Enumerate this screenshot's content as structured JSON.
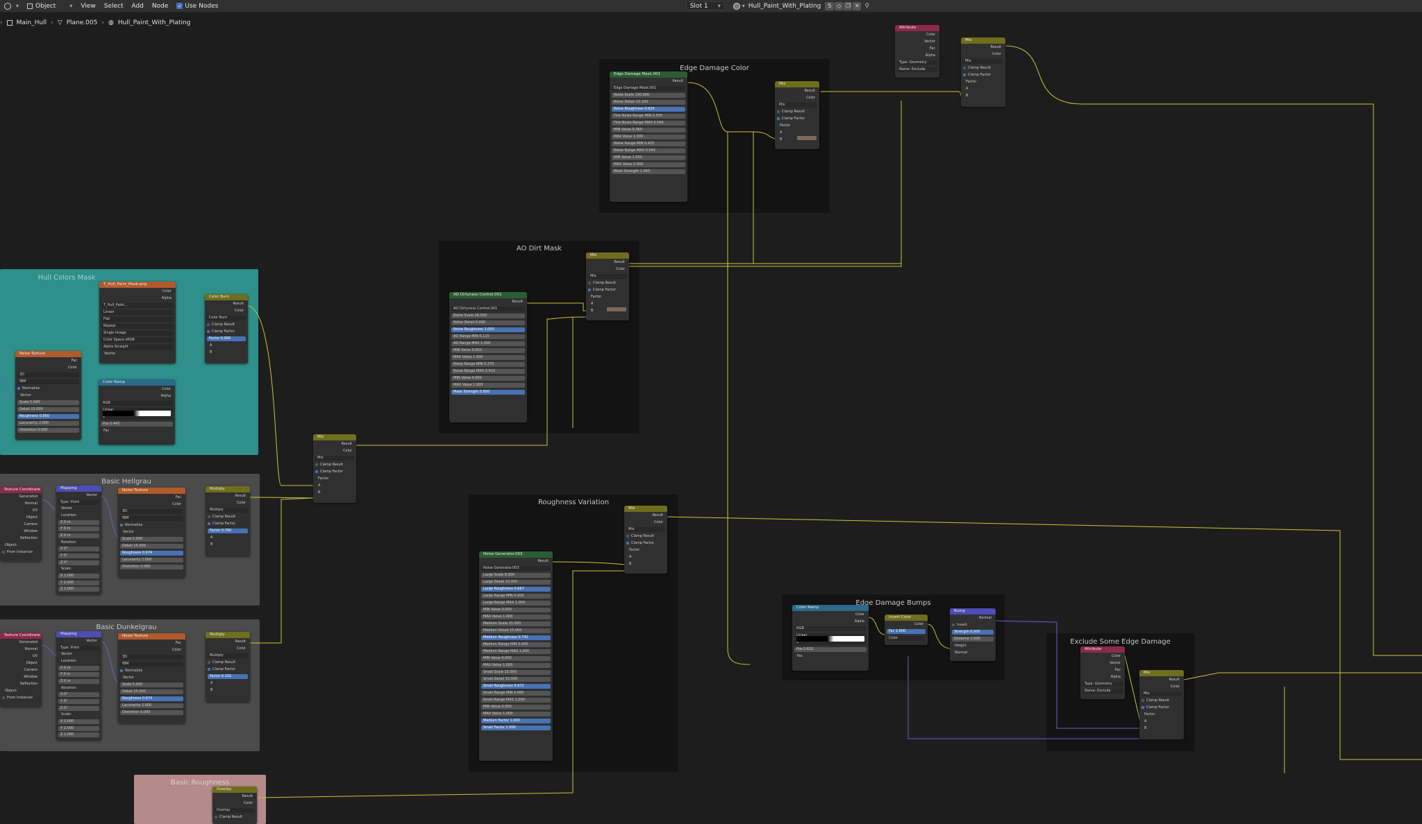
{
  "header": {
    "mode": "Object",
    "menus": [
      "View",
      "Select",
      "Add",
      "Node"
    ],
    "use_nodes": "Use Nodes",
    "slot": "Slot 1",
    "material": "Hull_Paint_With_Plating",
    "user_count": "5"
  },
  "breadcrumb": [
    "Main_Hull",
    "Plane.005",
    "Hull_Paint_With_Plating"
  ],
  "frames": {
    "edge_damage_color": "Edge Damage Color",
    "ao_dirt_mask": "AO Dirt Mask",
    "hull_colors_mask": "Hull Colors Mask",
    "basic_hellgrau": "Basic Hellgrau",
    "roughness_variation": "Roughness Variation",
    "basic_dunkelgrau": "Basic Dunkelgrau",
    "basic_roughness": "Basic Roughness",
    "edge_damage_bumps": "Edge Damage Bumps",
    "exclude_edge_damage": "Exclude Some Edge Damage"
  },
  "nodes": {
    "edge_mask": {
      "title": "Edge Damage Mask.001",
      "rows": [
        "Result",
        "Edge Damage Mask.001",
        "Noise Scale 100.000",
        "Noise Detail 15.100",
        "Noise Roughness 0.620",
        "Fine Noise Range MIN 0.550",
        "Fine Noise Range MAX 0.560",
        "MIN Value 0.360",
        "MAX Value 1.000",
        "Noise Range MIN 0.425",
        "Noise Range MAX 0.545",
        "MIN Value 1.000",
        "MAX Value 0.000",
        "Mask Strength 1.000"
      ]
    },
    "mix_edge": {
      "title": "Mix",
      "rows": [
        "Result",
        "Color",
        "Mix",
        "Clamp Result",
        "Clamp Factor",
        "Factor",
        "A",
        "B"
      ]
    },
    "attribute_top": {
      "title": "Attribute",
      "rows": [
        "Color",
        "Vector",
        "Fac",
        "Alpha",
        "Type: Geometry",
        "Name: Exclude"
      ]
    },
    "mix_top": {
      "title": "Mix",
      "rows": [
        "Result",
        "Color",
        "Mix",
        "Clamp Result",
        "Clamp Factor",
        "Factor",
        "A",
        "B"
      ]
    },
    "mix_ao": {
      "title": "Mix",
      "rows": [
        "Result",
        "Color",
        "Mix",
        "Clamp Result",
        "Clamp Factor",
        "Factor",
        "A",
        "B"
      ]
    },
    "ao_control": {
      "title": "AO Dirtyness Control.001",
      "rows": [
        "Result",
        "AO Dirtyness Control.001",
        "Noise Scale 26.000",
        "Noise Detail 6.000",
        "Noise Roughness 1.000",
        "AO Range MIN 0.115",
        "AO Range MAX 1.000",
        "MIN Value 0.000",
        "MAX Value 1.000",
        "Noise Range MIN 0.370",
        "Noise Range MAX 0.410",
        "MIN Value 0.000",
        "MAX Value 1.000",
        "Mask Strength 0.650"
      ]
    },
    "image_texture": {
      "title": "T_Hull_Paint_Mask.png",
      "rows": [
        "Color",
        "Alpha",
        "T_Hull_Paint...",
        "Linear",
        "Flat",
        "Repeat",
        "Single Image",
        "Color Space sRGB",
        "Alpha Straight",
        "Vector"
      ]
    },
    "color_burn": {
      "title": "Color Burn",
      "rows": [
        "Result",
        "Color",
        "Color Burn",
        "Clamp Result",
        "Clamp Factor",
        "Factor 0.900",
        "A",
        "B"
      ]
    },
    "noise_hull": {
      "title": "Noise Texture",
      "rows": [
        "Fac",
        "Color",
        "3D",
        "fBM",
        "Normalize",
        "Vector",
        "Scale 5.000",
        "Detail 15.000",
        "Roughness 0.850",
        "Lacunarity 2.000",
        "Distortion 0.000"
      ]
    },
    "color_ramp": {
      "title": "Color Ramp",
      "rows": [
        "Color",
        "Alpha",
        "RGB",
        "Linear",
        "1",
        "Pos 0.445",
        "Fac"
      ]
    },
    "mix_center": {
      "title": "Mix",
      "rows": [
        "Result",
        "Color",
        "Mix",
        "Clamp Result",
        "Clamp Factor",
        "Factor",
        "A",
        "B"
      ]
    },
    "texcoord_1": {
      "title": "Texture Coordinate",
      "rows": [
        "Generated",
        "Normal",
        "UV",
        "Object",
        "Camera",
        "Window",
        "Reflection",
        "Object:",
        "From Instancer"
      ]
    },
    "mapping_1": {
      "title": "Mapping",
      "rows": [
        "Vector",
        "Type: Point",
        "Vector",
        "Location:",
        "X 0 m",
        "Y 0 m",
        "Z 0 m",
        "Rotation:",
        "X 0°",
        "Y 0°",
        "Z 0°",
        "Scale:",
        "X 2.000",
        "Y 2.000",
        "Z 2.000"
      ]
    },
    "noise_hell": {
      "title": "Noise Texture",
      "rows": [
        "Fac",
        "Color",
        "3D",
        "fBM",
        "Normalize",
        "Vector",
        "Scale 5.000",
        "Detail 15.000",
        "Roughness 0.674",
        "Lacunarity 2.000",
        "Distortion 0.000"
      ]
    },
    "multiply_hell": {
      "title": "Multiply",
      "rows": [
        "Result",
        "Color",
        "Multiply",
        "Clamp Result",
        "Clamp Factor",
        "Factor 0.700",
        "A",
        "B"
      ]
    },
    "noise_gen": {
      "title": "Noise Generator.003",
      "rows": [
        "Result",
        "Noise Generator.003",
        "Large Scale 8.000",
        "Large Detail 15.000",
        "Large Roughness 0.667",
        "Large Range MIN 0.000",
        "Large Range MAX 1.000",
        "MIN Value 0.000",
        "MAX Value 1.000",
        "Medium Scale 15.000",
        "Medium Detail 15.000",
        "Medium Roughness 0.742",
        "Medium Range MIN 0.000",
        "Medium Range MAX 1.000",
        "MIN Value 0.000",
        "MAX Value 1.000",
        "Small Scale 15.000",
        "Small Detail 15.000",
        "Small Roughness 0.672",
        "Small Range MIN 0.000",
        "Small Range MAX 1.000",
        "MIN Value 0.000",
        "MAX Value 1.000",
        "Medium Factor 1.000",
        "Small Factor 1.000"
      ]
    },
    "mix_rough": {
      "title": "Mix",
      "rows": [
        "Result",
        "Color",
        "Mix",
        "Clamp Result",
        "Clamp Factor",
        "Factor",
        "A",
        "B"
      ]
    },
    "texcoord_2": {
      "title": "Texture Coordinate",
      "rows": [
        "Generated",
        "Normal",
        "UV",
        "Object",
        "Camera",
        "Window",
        "Reflection",
        "Object:",
        "From Instancer"
      ]
    },
    "mapping_2": {
      "title": "Mapping",
      "rows": [
        "Vector",
        "Type: Point",
        "Vector",
        "Location:",
        "X 0 m",
        "Y 0 m",
        "Z 0 m",
        "Rotation:",
        "X 0°",
        "Y 0°",
        "Z 0°",
        "Scale:",
        "X 2.000",
        "Y 2.000",
        "Z 2.000"
      ]
    },
    "noise_dunkel": {
      "title": "Noise Texture",
      "rows": [
        "Fac",
        "Color",
        "3D",
        "fBM",
        "Normalize",
        "Vector",
        "Scale 5.000",
        "Detail 15.000",
        "Roughness 0.674",
        "Lacunarity 2.000",
        "Distortion 0.000"
      ]
    },
    "multiply_dunkel": {
      "title": "Multiply",
      "rows": [
        "Result",
        "Color",
        "Multiply",
        "Clamp Result",
        "Clamp Factor",
        "Factor 0.310",
        "A",
        "B"
      ]
    },
    "overlay": {
      "title": "Overlay",
      "rows": [
        "Result",
        "Color",
        "Overlay",
        "Clamp Result"
      ]
    },
    "color_ramp_2": {
      "title": "Color Ramp",
      "rows": [
        "Color",
        "Alpha",
        "RGB",
        "Linear",
        "1",
        "Pos 0.615",
        "Fac"
      ]
    },
    "invert_color": {
      "title": "Invert Color",
      "rows": [
        "Color",
        "Fac 1.000",
        "Color"
      ]
    },
    "bump": {
      "title": "Bump",
      "rows": [
        "Normal",
        "Invert",
        "Strength 0.500",
        "Distance 1.000",
        "Height",
        "Normal"
      ]
    },
    "attribute_2": {
      "title": "Attribute",
      "rows": [
        "Color",
        "Vector",
        "Fac",
        "Alpha",
        "Type: Geometry",
        "Name: Exclude"
      ]
    },
    "mix_exclude": {
      "title": "Mix",
      "rows": [
        "Result",
        "Color",
        "Mix",
        "Clamp Result",
        "Clamp Factor",
        "Factor",
        "A",
        "B"
      ]
    }
  },
  "colors": {
    "node_bg": "#303030",
    "header_mix": "#6e6e1d",
    "header_group": "#2a5d33",
    "header_texture": "#b25a2c",
    "header_converter": "#2a6a8a",
    "header_input": "#8c2a4a",
    "header_vector": "#4d4db3",
    "wire_float": "#c7c73e",
    "wire_vector": "#6363c7",
    "frame_teal": "#2f8f8a",
    "frame_gray": "#4b4b4b",
    "frame_pink": "#b48a8a",
    "frame_dark": "#131313"
  }
}
